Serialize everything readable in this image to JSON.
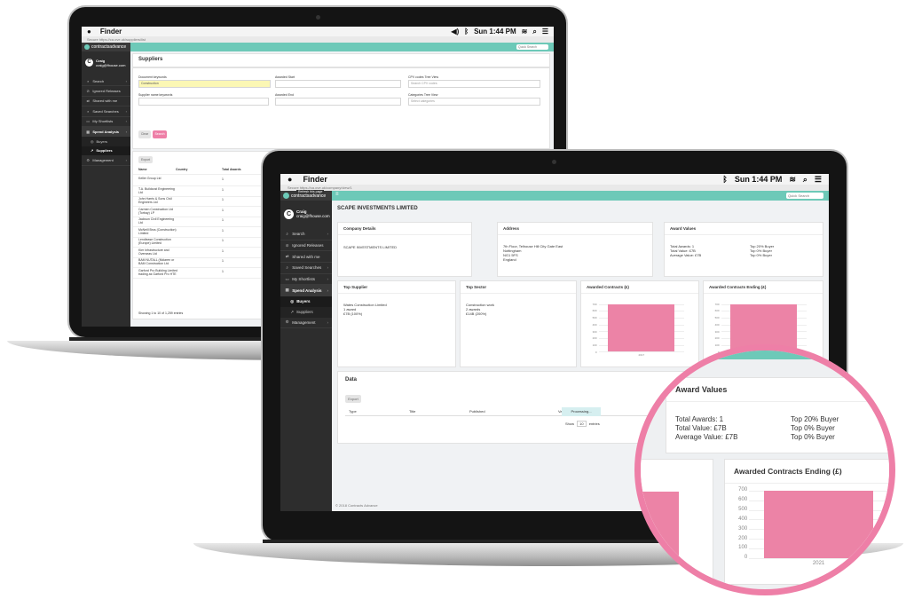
{
  "mac": {
    "app_name": "Finder",
    "clock": "Sun 1:44 PM"
  },
  "back_laptop": {
    "url_text": "Secure  https://ca.ove.uk/suppliers/list",
    "logo": "contractsadvance",
    "user": {
      "initial": "C",
      "name": "Craig",
      "email": "craig@fhouse.com"
    },
    "nav": [
      {
        "label": "Search",
        "icon": "search-icon",
        "chevron": true
      },
      {
        "label": "Ignored Releases",
        "icon": "ignore-icon",
        "chevron": false
      },
      {
        "label": "Shared with me",
        "icon": "share-icon",
        "chevron": false
      },
      {
        "label": "Saved Searches",
        "icon": "search-icon",
        "chevron": true
      },
      {
        "label": "My Shortlists",
        "icon": "folder-icon",
        "chevron": true
      },
      {
        "label": "Spend Analysis",
        "icon": "chart-icon",
        "chevron": true,
        "active": true
      }
    ],
    "subnav": [
      {
        "label": "Buyers"
      },
      {
        "label": "Suppliers",
        "selected": true
      }
    ],
    "nav_after": [
      {
        "label": "Management",
        "icon": "gear-icon",
        "chevron": true
      }
    ],
    "quick_search": "Quick Search",
    "page_title": "Suppliers",
    "form": {
      "doc_keywords_label": "Document keywords",
      "doc_keywords_value": "Construction",
      "awarded_start_label": "Awarded Start",
      "cpv_label": "CPV codes",
      "cpv_tree": "Tree View",
      "cpv_placeholder": "Search CPV codes",
      "supplier_keywords_label": "Supplier name keywords",
      "awarded_end_label": "Awarded End",
      "categories_label": "Categories",
      "categories_tree": "Tree View",
      "categories_placeholder": "Select categories",
      "clear": "Clear",
      "search": "Search"
    },
    "export": "Export",
    "table_headers": [
      "Name",
      "Country",
      "Total Awards"
    ],
    "rows": [
      {
        "name": "Keller Group Ltd",
        "awards": "1"
      },
      {
        "name": "T.A. Buildcost Engineering Ltd",
        "awards": "1"
      },
      {
        "name": "John Harris & Sons Civil Engineers Ltd",
        "awards": "1"
      },
      {
        "name": "Carmen Construction Ltd (Torbay) LP",
        "awards": "1"
      },
      {
        "name": "Jackson Civil Engineering Ltd",
        "awards": "1"
      },
      {
        "name": "McNeill Bros (Construction) Limited",
        "awards": "1"
      },
      {
        "name": "Lendlease Construction (Europe) Limited",
        "awards": "1"
      },
      {
        "name": "Kier Infrastructure and Overseas Ltd",
        "awards": "1"
      },
      {
        "name": "BAM NUTALL (Mclaren or BAM Construction Ltd",
        "awards": "1"
      },
      {
        "name": "Garford Pro Building Limited trading as Garford Pro HTE",
        "awards": "1"
      }
    ],
    "footer": "Showing 1 to 10 of 1,259 entries"
  },
  "front_laptop": {
    "url_text": "Secure  https://ca.ove.uk/company/view/1",
    "tooltip": "Refresh this page",
    "logo": "contractsadvance",
    "user": {
      "initial": "C",
      "name": "Craig",
      "email": "craig@fhouse.com"
    },
    "nav": [
      {
        "label": "Search",
        "icon": "search-icon",
        "chevron": true
      },
      {
        "label": "Ignored Releases",
        "icon": "ignore-icon",
        "chevron": false
      },
      {
        "label": "Shared with me",
        "icon": "share-icon",
        "chevron": false
      },
      {
        "label": "Saved Searches",
        "icon": "search-icon",
        "chevron": true
      },
      {
        "label": "My Shortlists",
        "icon": "folder-icon",
        "chevron": true
      },
      {
        "label": "Spend Analysis",
        "icon": "chart-icon",
        "chevron": true,
        "active": true
      }
    ],
    "subnav": [
      {
        "label": "Buyers",
        "selected": true
      },
      {
        "label": "Suppliers"
      }
    ],
    "nav_after": [
      {
        "label": "Management",
        "icon": "gear-icon",
        "chevron": true
      }
    ],
    "quick_search": "Quick Search",
    "page_title": "SCAPE INVESTMENTS LIMITED",
    "company": {
      "title": "Company Details",
      "name": "SCAPE INVESTMENTS LIMITED"
    },
    "address": {
      "title": "Address",
      "lines": [
        "7th Floor, Telhouse Hill City Gate East",
        "Nottingham",
        "NG1 5FS",
        "England"
      ]
    },
    "award_values": {
      "title": "Award Values",
      "left": [
        "Total Awards: 1",
        "Total Value: £7B",
        "Average Value: £7B"
      ],
      "right": [
        "Top 20% Buyer",
        "Top 0% Buyer",
        "Top 0% Buyer"
      ]
    },
    "top_supplier": {
      "title": "Top Supplier",
      "lines": [
        "Wates Construction Limited",
        "1 award",
        "£7B (100%)"
      ]
    },
    "top_sector": {
      "title": "Top Sector",
      "lines": [
        "Construction work",
        "2 awards",
        "£14B (200%)"
      ]
    },
    "chart1_title": "Awarded Contracts (£)",
    "chart2_title": "Awarded Contracts Ending (£)",
    "data_title": "Data",
    "export": "Export",
    "data_headers": [
      "Type",
      "Title",
      "Published",
      "Va"
    ],
    "processing": "Processing...",
    "show_prefix": "Show",
    "show_value": "10",
    "show_suffix": "entries",
    "footer": "© 2018 Contracts Advance"
  },
  "chart_data": [
    {
      "type": "bar",
      "title": "Awarded Contracts (£)",
      "categories": [
        "2017"
      ],
      "values": [
        700
      ],
      "ylim": [
        0,
        700
      ],
      "yticks": [
        "700",
        "600",
        "500",
        "400",
        "300",
        "200",
        "100",
        "0"
      ],
      "grid": true,
      "color": "#ec83a6"
    },
    {
      "type": "bar",
      "title": "Awarded Contracts Ending (£)",
      "categories": [
        "2021"
      ],
      "values": [
        700
      ],
      "ylim": [
        0,
        700
      ],
      "yticks": [
        "700",
        "600",
        "500",
        "400",
        "300",
        "200",
        "100",
        "0"
      ],
      "grid": true,
      "color": "#ec83a6"
    }
  ],
  "magnifier": {
    "award_title": "Award Values",
    "left": [
      "Total Awards: 1",
      "Total Value: £7B",
      "Average Value: £7B"
    ],
    "right": [
      "Top 20% Buyer",
      "Top 0% Buyer",
      "Top 0% Buyer"
    ],
    "chart_title": "Awarded Contracts Ending (£)",
    "yticks": [
      "700",
      "600",
      "500",
      "400",
      "300",
      "200",
      "100",
      "0"
    ],
    "category": "2021"
  },
  "colors": {
    "accent": "#6dc9b8",
    "pink": "#ee7fa7",
    "bar": "#ec83a6",
    "sidebar": "#2d2d2d"
  }
}
